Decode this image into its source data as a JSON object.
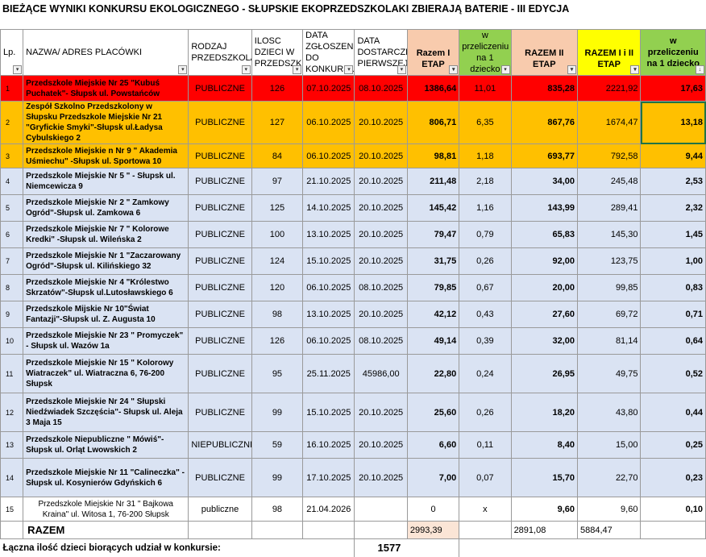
{
  "title": "BIEŻĄCE WYNIKI KONKURSU EKOLOGICZNEGO - SŁUPSKIE EKOPRZEDSZKOLAKI ZBIERAJĄ BATERIE - III EDYCJA",
  "headers": {
    "lp": "Lp.",
    "name": "NAZWA/ ADRES PLACÓWKI",
    "type": "RODZAJ PRZEDSZKOLA",
    "kids": "ILOSC DZIECI W PRZEDSZKOLU",
    "date_reg": "DATA ZGŁOSZENIA DO KONKURSU",
    "date_first": "DATA DOSTARCZENIA PIERWSZEJ",
    "stage1": "Razem I ETAP",
    "per1": "w przeliczeniu na 1 dziecko",
    "stage2": "RAZEM II ETAP",
    "stage12": "RAZEM I i II ETAP",
    "per_total": "w przeliczeniu na 1 dziecko"
  },
  "filter_icon": "dropdown-arrow-icon",
  "sort_icon": "sort-desc-icon",
  "rows": [
    {
      "lp": "1",
      "name": "Przedszkole Miejskie Nr 25 \"Kubuś Puchatek\"- Słupsk ul. Powstańców",
      "type": "PUBLICZNE",
      "kids": "126",
      "date_reg": "07.10.2025",
      "date_first": "08.10.2025",
      "s1": "1386,64",
      "p1": "11,01",
      "s2": "835,28",
      "s12": "2221,92",
      "pt": "17,63",
      "color": "red"
    },
    {
      "lp": "2",
      "name": "Zespół Szkolno Przedszkolony w Słupsku Przedszkole Miejskie Nr 21 \"Gryfickie Smyki\"-Słupsk ul.Ładysa Cybulskiego 2",
      "type": "PUBLICZNE",
      "kids": "127",
      "date_reg": "06.10.2025",
      "date_first": "20.10.2025",
      "s1": "806,71",
      "p1": "6,35",
      "s2": "867,76",
      "s12": "1674,47",
      "pt": "13,18",
      "color": "orange"
    },
    {
      "lp": "3",
      "name": "Przedszkole Miejskie n Nr 9 \" Akademia Uśmiechu\" -Słupsk ul. Sportowa 10",
      "type": "PUBLICZNE",
      "kids": "84",
      "date_reg": "06.10.2025",
      "date_first": "20.10.2025",
      "s1": "98,81",
      "p1": "1,18",
      "s2": "693,77",
      "s12": "792,58",
      "pt": "9,44",
      "color": "orange"
    },
    {
      "lp": "4",
      "name": "Przedszkole Miejskie Nr 5 \" - Słupsk ul. Niemcewicza 9",
      "type": "PUBLICZNE",
      "kids": "97",
      "date_reg": "21.10.2025",
      "date_first": "20.10.2025",
      "s1": "211,48",
      "p1": "2,18",
      "s2": "34,00",
      "s12": "245,48",
      "pt": "2,53",
      "color": "blue"
    },
    {
      "lp": "5",
      "name": "Przedszkole Miejskie Nr 2 \" Zamkowy Ogród\"-Słupsk ul. Zamkowa 6",
      "type": "PUBLICZNE",
      "kids": "125",
      "date_reg": "14.10.2025",
      "date_first": "20.10.2025",
      "s1": "145,42",
      "p1": "1,16",
      "s2": "143,99",
      "s12": "289,41",
      "pt": "2,32",
      "color": "blue"
    },
    {
      "lp": "6",
      "name": "Przedszkole Miejskie Nr 7 \" Kolorowe Kredki\" -Słupsk ul. Wileńska 2",
      "type": "PUBLICZNE",
      "kids": "100",
      "date_reg": "13.10.2025",
      "date_first": "20.10.2025",
      "s1": "79,47",
      "p1": "0,79",
      "s2": "65,83",
      "s12": "145,30",
      "pt": "1,45",
      "color": "blue"
    },
    {
      "lp": "7",
      "name": "Przedszkole Miejskie Nr 1 \"Zaczarowany Ogród\"-Słupsk ul. Kilińskiego 32",
      "type": "PUBLICZNE",
      "kids": "124",
      "date_reg": "15.10.2025",
      "date_first": "20.10.2025",
      "s1": "31,75",
      "p1": "0,26",
      "s2": "92,00",
      "s12": "123,75",
      "pt": "1,00",
      "color": "blue"
    },
    {
      "lp": "8",
      "name": "Przedszkole Miejskie Nr 4 \"Królestwo Skrzatów\"-Słupsk ul.Lutosławskiego 6",
      "type": "PUBLICZNE",
      "kids": "120",
      "date_reg": "06.10.2025",
      "date_first": "08.10.2025",
      "s1": "79,85",
      "p1": "0,67",
      "s2": "20,00",
      "s12": "99,85",
      "pt": "0,83",
      "color": "blue"
    },
    {
      "lp": "9",
      "name": "Przedszkole Mijskie Nr 10\"Świat Fantazji\"-Słupsk ul. Z. Augusta 10",
      "type": "PUBLICZNE",
      "kids": "98",
      "date_reg": "13.10.2025",
      "date_first": "20.10.2025",
      "s1": "42,12",
      "p1": "0,43",
      "s2": "27,60",
      "s12": "69,72",
      "pt": "0,71",
      "color": "blue"
    },
    {
      "lp": "10",
      "name": "Przedszkole Miejskie Nr 23 \" Promyczek\" - Słupsk ul. Wazów 1a",
      "type": "PUBLICZNE",
      "kids": "126",
      "date_reg": "06.10.2025",
      "date_first": "08.10.2025",
      "s1": "49,14",
      "p1": "0,39",
      "s2": "32,00",
      "s12": "81,14",
      "pt": "0,64",
      "color": "blue"
    },
    {
      "lp": "11",
      "name": "Przedszkole Miejskie Nr 15 \" Kolorowy Wiatraczek\" ul. Wiatraczna 6, 76-200 Słupsk",
      "type": "PUBLICZNE",
      "kids": "95",
      "date_reg": "25.11.2025",
      "date_first": "45986,00",
      "s1": "22,80",
      "p1": "0,24",
      "s2": "26,95",
      "s12": "49,75",
      "pt": "0,52",
      "color": "blue"
    },
    {
      "lp": "12",
      "name": "Przedszkole Miejskie Nr 24 \" Słupski Niedźwiadek Szczęścia\"- Słupsk ul. Aleja 3 Maja 15",
      "type": "PUBLICZNE",
      "kids": "99",
      "date_reg": "15.10.2025",
      "date_first": "20.10.2025",
      "s1": "25,60",
      "p1": "0,26",
      "s2": "18,20",
      "s12": "43,80",
      "pt": "0,44",
      "color": "blue"
    },
    {
      "lp": "13",
      "name": "Przedszkole Niepubliczne \" Mówiś\"- Słupsk ul. Orląt Lwowskich 2",
      "type": "NIEPUBLICZNE",
      "kids": "59",
      "date_reg": "16.10.2025",
      "date_first": "20.10.2025",
      "s1": "6,60",
      "p1": "0,11",
      "s2": "8,40",
      "s12": "15,00",
      "pt": "0,25",
      "color": "blue"
    },
    {
      "lp": "14",
      "name": "Przedszkole Miejskie Nr 11 \"Calineczka\" - Słupsk ul. Kosynierów Gdyńskich 6",
      "type": "PUBLICZNE",
      "kids": "99",
      "date_reg": "17.10.2025",
      "date_first": "20.10.2025",
      "s1": "7,00",
      "p1": "0,07",
      "s2": "15,70",
      "s12": "22,70",
      "pt": "0,23",
      "color": "blue"
    },
    {
      "lp": "15",
      "name": "Przedszkole Miejskie Nr 31 \" Bajkowa Kraina\" ul. Witosa 1, 76-200 Słupsk",
      "type": "publiczne",
      "kids": "98",
      "date_reg": "21.04.2026",
      "date_first": "",
      "s1": "0",
      "p1": "x",
      "s2": "9,60",
      "s12": "9,60",
      "pt": "0,10",
      "color": "plain"
    }
  ],
  "total": {
    "label": "RAZEM",
    "s1": "2993,39",
    "s2": "2891,08",
    "s12": "5884,47"
  },
  "footer": {
    "label": "Łączna ilość dzieci biorących udział w konkursie:",
    "value": "1577"
  },
  "colors": {
    "red_row": "#ff0000",
    "orange_row": "#ffc000",
    "blue_row": "#dae3f3",
    "peach_header": "#f8cbad",
    "green_header": "#92d050",
    "yellow_header": "#ffff00"
  }
}
